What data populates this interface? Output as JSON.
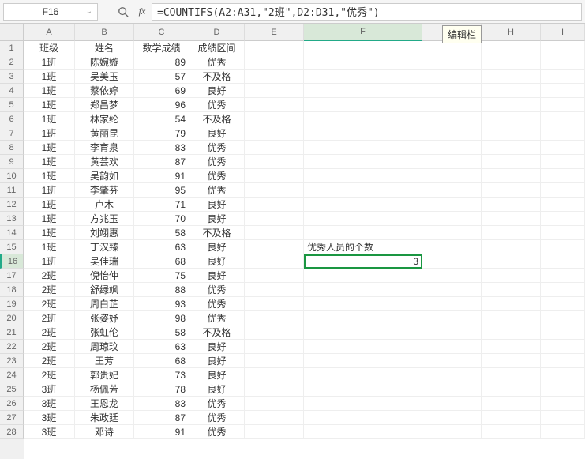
{
  "name_box": "F16",
  "fx_label": "fx",
  "formula": "=COUNTIFS(A2:A31,\"2班\",D2:D31,\"优秀\")",
  "tooltip": "编辑栏",
  "columns": [
    "A",
    "B",
    "C",
    "D",
    "E",
    "F",
    "G",
    "H",
    "I"
  ],
  "selected_col": "F",
  "row_start": 1,
  "row_end": 28,
  "selected_row": 16,
  "headers": {
    "A": "班级",
    "B": "姓名",
    "C": "数学成绩",
    "D": "成绩区间"
  },
  "data": [
    {
      "A": "1班",
      "B": "陈婉嫙",
      "C": 89,
      "D": "优秀"
    },
    {
      "A": "1班",
      "B": "吴美玉",
      "C": 57,
      "D": "不及格"
    },
    {
      "A": "1班",
      "B": "蔡依婷",
      "C": 69,
      "D": "良好"
    },
    {
      "A": "1班",
      "B": "郑昌梦",
      "C": 96,
      "D": "优秀"
    },
    {
      "A": "1班",
      "B": "林家纶",
      "C": 54,
      "D": "不及格"
    },
    {
      "A": "1班",
      "B": "黄丽昆",
      "C": 79,
      "D": "良好"
    },
    {
      "A": "1班",
      "B": "李育泉",
      "C": 83,
      "D": "优秀"
    },
    {
      "A": "1班",
      "B": "黄芸欢",
      "C": 87,
      "D": "优秀"
    },
    {
      "A": "1班",
      "B": "吴韵如",
      "C": 91,
      "D": "优秀"
    },
    {
      "A": "1班",
      "B": "李肇芬",
      "C": 95,
      "D": "优秀"
    },
    {
      "A": "1班",
      "B": "卢木",
      "C": 71,
      "D": "良好"
    },
    {
      "A": "1班",
      "B": "方兆玉",
      "C": 70,
      "D": "良好"
    },
    {
      "A": "1班",
      "B": "刘翊惠",
      "C": 58,
      "D": "不及格"
    },
    {
      "A": "1班",
      "B": "丁汉臻",
      "C": 63,
      "D": "良好"
    },
    {
      "A": "1班",
      "B": "吴佳瑞",
      "C": 68,
      "D": "良好"
    },
    {
      "A": "2班",
      "B": "倪怡仲",
      "C": 75,
      "D": "良好"
    },
    {
      "A": "2班",
      "B": "舒绿飒",
      "C": 88,
      "D": "优秀"
    },
    {
      "A": "2班",
      "B": "周白芷",
      "C": 93,
      "D": "优秀"
    },
    {
      "A": "2班",
      "B": "张姿妤",
      "C": 98,
      "D": "优秀"
    },
    {
      "A": "2班",
      "B": "张虹伦",
      "C": 58,
      "D": "不及格"
    },
    {
      "A": "2班",
      "B": "周琼玟",
      "C": 63,
      "D": "良好"
    },
    {
      "A": "2班",
      "B": "王芳",
      "C": 68,
      "D": "良好"
    },
    {
      "A": "2班",
      "B": "郭贵妃",
      "C": 73,
      "D": "良好"
    },
    {
      "A": "3班",
      "B": "杨佩芳",
      "C": 78,
      "D": "良好"
    },
    {
      "A": "3班",
      "B": "王恩龙",
      "C": 83,
      "D": "优秀"
    },
    {
      "A": "3班",
      "B": "朱政廷",
      "C": 87,
      "D": "优秀"
    },
    {
      "A": "3班",
      "B": "邓诗",
      "C": 91,
      "D": "优秀"
    }
  ],
  "f15_label": "优秀人员的个数",
  "f16_value": "3"
}
